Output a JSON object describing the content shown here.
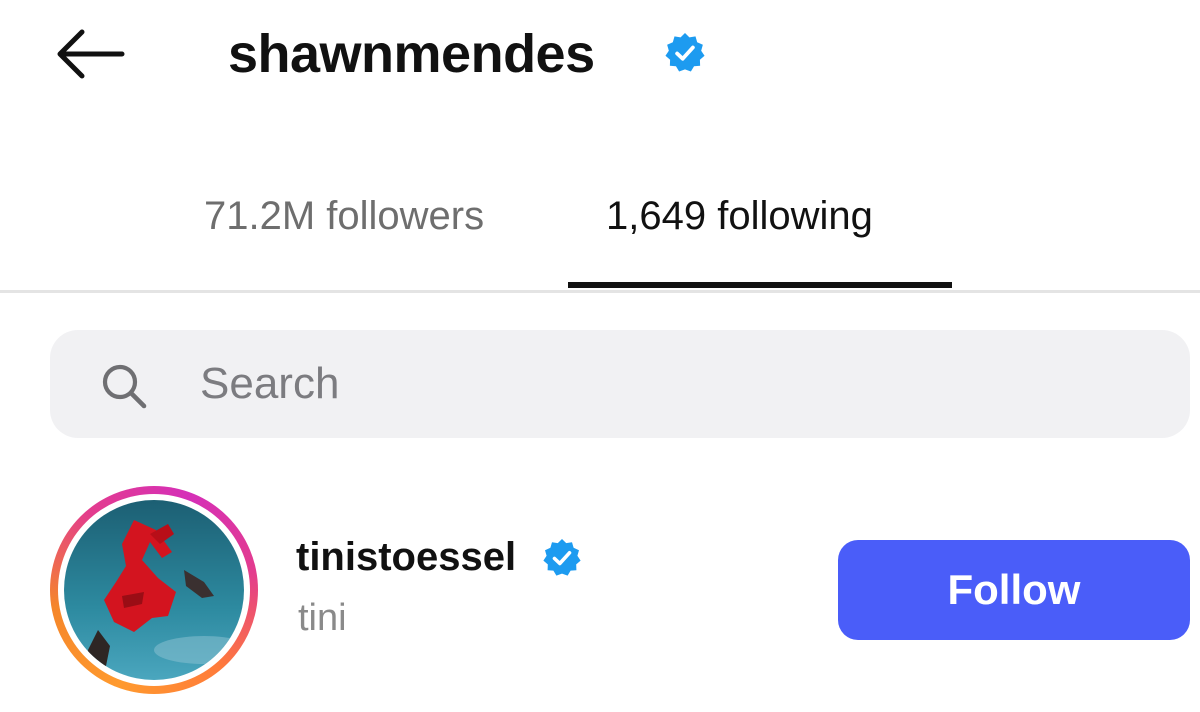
{
  "header": {
    "title": "shawnmendes",
    "back_icon": "arrow-left-icon",
    "verified_icon": "verified-badge-icon"
  },
  "tabs": [
    {
      "label": "71.2M followers",
      "active": false
    },
    {
      "label": "1,649 following",
      "active": true
    }
  ],
  "search": {
    "placeholder": "Search",
    "value": "",
    "icon": "search-icon"
  },
  "list": [
    {
      "username": "tinistoesse​l",
      "full_name": "tini",
      "verified": true,
      "story_ring": true,
      "button_label": "Follow"
    }
  ],
  "colors": {
    "accent_button": "#4a5df9",
    "verified_blue": "#1d9bf0",
    "inactive_tab": "#6e6e6e",
    "text_primary": "#111111",
    "search_bg": "#f1f1f3"
  }
}
